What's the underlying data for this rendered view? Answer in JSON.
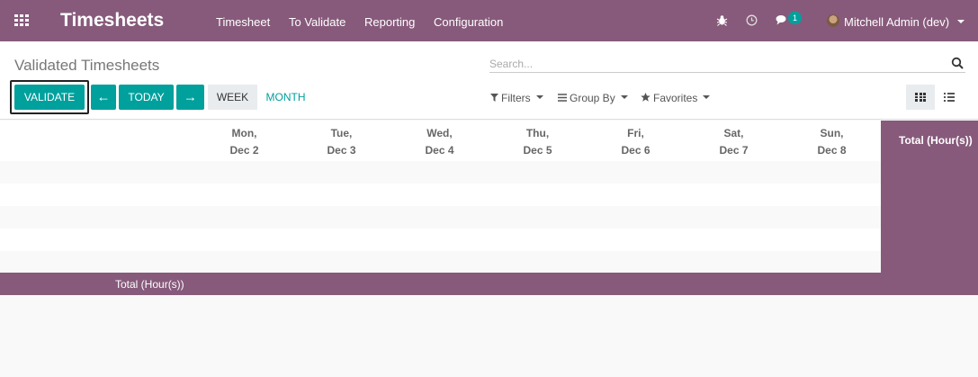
{
  "navbar": {
    "brand": "Timesheets",
    "menu": [
      "Timesheet",
      "To Validate",
      "Reporting",
      "Configuration"
    ],
    "chat_count": "1",
    "user": "Mitchell Admin (dev)"
  },
  "control_panel": {
    "title": "Validated Timesheets",
    "search_placeholder": "Search...",
    "validate_label": "VALIDATE",
    "today_label": "TODAY",
    "week_label": "WEEK",
    "month_label": "MONTH",
    "filters_label": "Filters",
    "groupby_label": "Group By",
    "favorites_label": "Favorites"
  },
  "grid": {
    "days": [
      {
        "dow": "Mon,",
        "date": "Dec 2"
      },
      {
        "dow": "Tue,",
        "date": "Dec 3"
      },
      {
        "dow": "Wed,",
        "date": "Dec 4"
      },
      {
        "dow": "Thu,",
        "date": "Dec 5"
      },
      {
        "dow": "Fri,",
        "date": "Dec 6"
      },
      {
        "dow": "Sat,",
        "date": "Dec 7"
      },
      {
        "dow": "Sun,",
        "date": "Dec 8"
      }
    ],
    "total_column_label": "Total (Hour(s))",
    "total_row_label": "Total (Hour(s))"
  },
  "colors": {
    "brand": "#875a7b",
    "primary": "#00a09d"
  }
}
